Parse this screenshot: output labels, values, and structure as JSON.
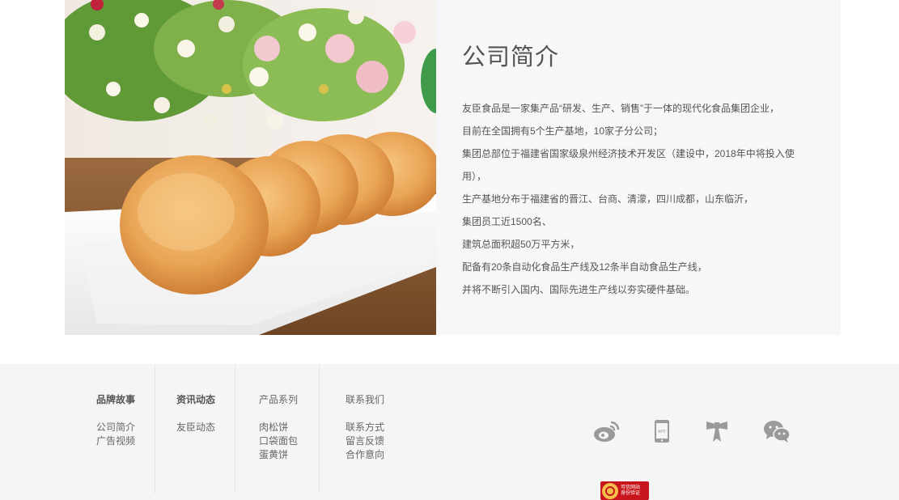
{
  "intro": {
    "title": "公司简介",
    "paragraphs": [
      "友臣食品是一家集产品“研发、生产、销售”于一体的现代化食品集团企业，",
      "目前在全国拥有5个生产基地，10家子分公司；",
      "集团总部位于福建省国家级泉州经济技术开发区（建设中，2018年中将投入使",
      "用），",
      "生产基地分布于福建省的晋江、台商、清濛，四川成都，山东临沂，",
      "集团员工近1500名、",
      "建筑总面积超50万平方米，",
      "配备有20条自动化食品生产线及12条半自动食品生产线，",
      "并将不断引入国内、国际先进生产线以夯实硬件基础。"
    ]
  },
  "footer": {
    "columns": [
      {
        "head": "品牌故事",
        "items": [
          "公司简介",
          "广告视频"
        ]
      },
      {
        "head": "资讯动态",
        "items": [
          "友臣动态"
        ]
      },
      {
        "head": "产品系列",
        "items": [
          "肉松饼",
          "口袋面包",
          "蛋黄饼"
        ]
      },
      {
        "head": "联系我们",
        "items": [
          "联系方式",
          "留言反馈",
          "合作意向"
        ]
      }
    ],
    "social": [
      {
        "icon": "weibo-icon"
      },
      {
        "icon": "mobile-app-icon",
        "label": "APP"
      },
      {
        "icon": "gift-ribbon-icon"
      },
      {
        "icon": "wechat-icon"
      }
    ],
    "badge": {
      "line1": "可信网站",
      "line2": "身份验证"
    }
  },
  "colors": {
    "text": "#555555",
    "intro_bg": "#f7f7f7",
    "footer_bg": "#f5f5f5",
    "icon_gray": "#9a9a9a",
    "badge_red": "#c8161d"
  }
}
